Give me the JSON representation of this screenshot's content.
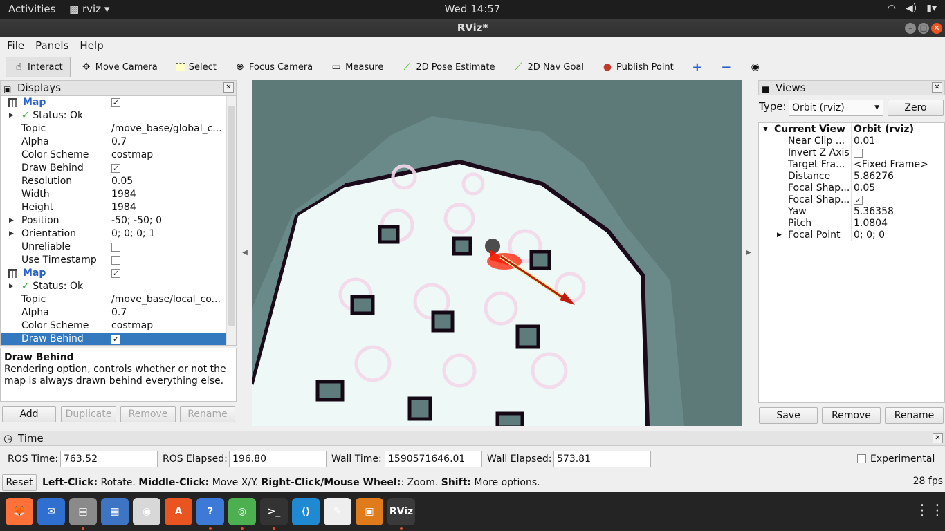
{
  "topbar": {
    "activities": "Activities",
    "app": "rviz",
    "clock": "Wed 14:57"
  },
  "window": {
    "title": "RViz*"
  },
  "menu": [
    "File",
    "Panels",
    "Help"
  ],
  "toolbar": {
    "interact": "Interact",
    "move_camera": "Move Camera",
    "select": "Select",
    "focus_camera": "Focus Camera",
    "measure": "Measure",
    "pose_estimate": "2D Pose Estimate",
    "nav_goal": "2D Nav Goal",
    "publish_point": "Publish Point"
  },
  "displays": {
    "title": "Displays",
    "rows": [
      {
        "key": "Map",
        "value": "",
        "type": "header",
        "checked": true
      },
      {
        "key": "Status: Ok",
        "value": "",
        "type": "status"
      },
      {
        "key": "Topic",
        "value": "/move_base/global_c..."
      },
      {
        "key": "Alpha",
        "value": "0.7"
      },
      {
        "key": "Color Scheme",
        "value": "costmap"
      },
      {
        "key": "Draw Behind",
        "value": "",
        "checked": true
      },
      {
        "key": "Resolution",
        "value": "0.05"
      },
      {
        "key": "Width",
        "value": "1984"
      },
      {
        "key": "Height",
        "value": "1984"
      },
      {
        "key": "Position",
        "value": "-50; -50; 0",
        "expandable": true
      },
      {
        "key": "Orientation",
        "value": "0; 0; 0; 1",
        "expandable": true
      },
      {
        "key": "Unreliable",
        "value": "",
        "checked": false
      },
      {
        "key": "Use Timestamp",
        "value": "",
        "checked": false
      },
      {
        "key": "Map",
        "value": "",
        "type": "header",
        "checked": true
      },
      {
        "key": "Status: Ok",
        "value": "",
        "type": "status"
      },
      {
        "key": "Topic",
        "value": "/move_base/local_co..."
      },
      {
        "key": "Alpha",
        "value": "0.7"
      },
      {
        "key": "Color Scheme",
        "value": "costmap"
      },
      {
        "key": "Draw Behind",
        "value": "",
        "checked": true,
        "selected": true
      }
    ],
    "desc_title": "Draw Behind",
    "desc_text": "Rendering option, controls whether or not the map is always drawn behind everything else.",
    "buttons": {
      "add": "Add",
      "duplicate": "Duplicate",
      "remove": "Remove",
      "rename": "Rename"
    }
  },
  "views": {
    "title": "Views",
    "type_label": "Type:",
    "type_value": "Orbit (rviz)",
    "zero": "Zero",
    "current_view": "Current View",
    "current_value": "Orbit (rviz)",
    "props": [
      {
        "key": "Near Clip ...",
        "value": "0.01"
      },
      {
        "key": "Invert Z Axis",
        "value": "",
        "checked": false
      },
      {
        "key": "Target Fra...",
        "value": "<Fixed Frame>"
      },
      {
        "key": "Distance",
        "value": "5.86276"
      },
      {
        "key": "Focal Shap...",
        "value": "0.05"
      },
      {
        "key": "Focal Shap...",
        "value": "",
        "checked": true
      },
      {
        "key": "Yaw",
        "value": "5.36358"
      },
      {
        "key": "Pitch",
        "value": "1.0804"
      },
      {
        "key": "Focal Point",
        "value": "0; 0; 0",
        "expandable": true
      }
    ],
    "buttons": {
      "save": "Save",
      "remove": "Remove",
      "rename": "Rename"
    }
  },
  "time": {
    "title": "Time",
    "ros_time_label": "ROS Time:",
    "ros_time": "763.52",
    "ros_elapsed_label": "ROS Elapsed:",
    "ros_elapsed": "196.80",
    "wall_time_label": "Wall Time:",
    "wall_time": "1590571646.01",
    "wall_elapsed_label": "Wall Elapsed:",
    "wall_elapsed": "573.81",
    "experimental": "Experimental"
  },
  "status": {
    "reset": "Reset",
    "left_click": "Left-Click:",
    "left_desc": " Rotate. ",
    "middle_click": "Middle-Click:",
    "middle_desc": " Move X/Y. ",
    "right_click": "Right-Click/Mouse Wheel:",
    "right_desc": ": Zoom. ",
    "shift": "Shift:",
    "shift_desc": " More options.",
    "fps": "28 fps"
  },
  "dock": [
    {
      "icon": "firefox-icon",
      "color": "#ff7139"
    },
    {
      "icon": "thunderbird-icon",
      "color": "#2f6fcf"
    },
    {
      "icon": "files-icon",
      "color": "#8a8a8a"
    },
    {
      "icon": "writer-icon",
      "color": "#3d74c4"
    },
    {
      "icon": "rhythmbox-icon",
      "color": "#d8d8d8"
    },
    {
      "icon": "software-icon",
      "color": "#e95420"
    },
    {
      "icon": "help-icon",
      "color": "#3d79d6"
    },
    {
      "icon": "chrome-icon",
      "color": "#4caf50"
    },
    {
      "icon": "terminal-icon",
      "color": "#333333"
    },
    {
      "icon": "vscode-icon",
      "color": "#1f8ad2"
    },
    {
      "icon": "text-editor-icon",
      "color": "#eeeeee"
    },
    {
      "icon": "virtualbox-icon",
      "color": "#e07b1c"
    },
    {
      "icon": "rviz-icon",
      "color": "#3a3a3a",
      "label": "RViz"
    }
  ]
}
